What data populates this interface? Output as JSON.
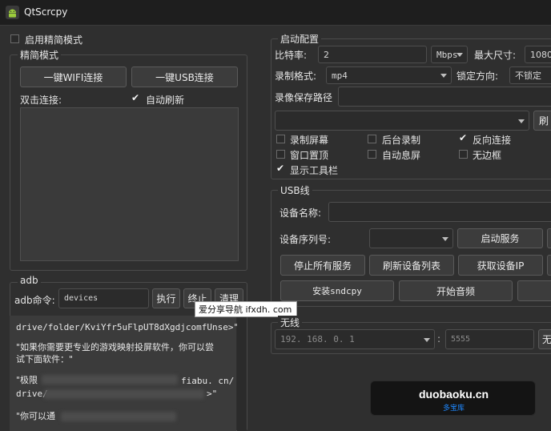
{
  "window": {
    "title": "QtScrcpy"
  },
  "left": {
    "simple_mode_label": "启用精简模式",
    "simple_group_title": "精简模式",
    "wifi_connect": "一键WIFI连接",
    "usb_connect": "一键USB连接",
    "double_click_label": "双击连接:",
    "auto_refresh_label": "自动刷新",
    "adb_group_title": "adb",
    "adb_cmd_label": "adb命令:",
    "adb_cmd_value": "devices",
    "exec_btn": "执行",
    "stop_btn": "终止",
    "clear_btn": "清理",
    "log_lines": [
      "drive/folder/KviYfr5uFlpUT8dXgdjcomfUnse>\"",
      "\"如果你需要更专业的游戏映射投屏软件，你可以尝",
      "试下面软件：\"",
      "\"极限",
      "drive/",
      "\"你可以通"
    ],
    "log_line3_tail": "fiabu. cn/",
    "log_line4_tail": ">\""
  },
  "config": {
    "group_title": "启动配置",
    "bitrate_label": "比特率:",
    "bitrate_value": "2",
    "bitrate_unit": "Mbps",
    "max_size_label": "最大尺寸:",
    "max_size_value": "1080",
    "record_format_label": "录制格式:",
    "record_format_value": "mp4",
    "lock_dir_label": "锁定方向:",
    "lock_dir_value": "不锁定",
    "record_path_label": "录像保存路径",
    "refresh_short": "刷",
    "opt_record_screen": "录制屏幕",
    "opt_bg_record": "后台录制",
    "opt_reverse": "反向连接",
    "opt_top": "窗口置顶",
    "opt_auto_off": "自动息屏",
    "opt_frameless": "无边框",
    "opt_toolbar": "显示工具栏"
  },
  "usb": {
    "group_title": "USB线",
    "device_name_label": "设备名称:",
    "serial_label": "设备序列号:",
    "start_service": "启动服务",
    "stop_all": "停止所有服务",
    "refresh_devices": "刷新设备列表",
    "get_ip": "获取设备IP",
    "install_sndcpy": "安装sndcpy",
    "start_audio": "开始音频"
  },
  "wireless": {
    "group_title": "无线",
    "ip_value": "192. 168. 0. 1",
    "port_value": "5555",
    "connect_short": "无"
  },
  "overlay": {
    "tooltip": "爱分享导航 ifxdh. com",
    "watermark_main": "duobaoku.cn",
    "watermark_sub": "多宝库"
  },
  "colors": {
    "accent": "#1e88ff",
    "bg": "#2f2f2f"
  }
}
